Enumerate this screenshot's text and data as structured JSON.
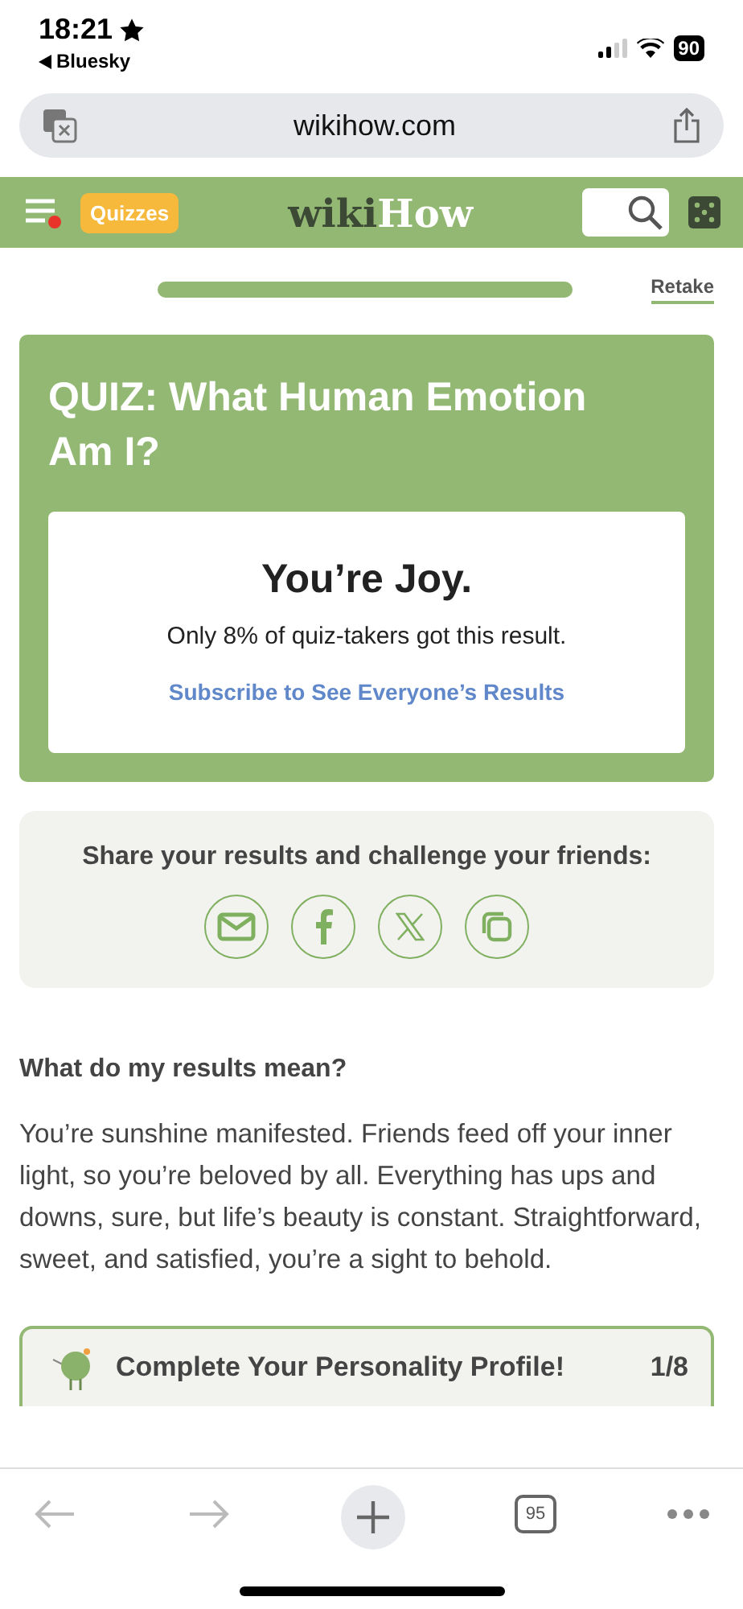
{
  "status_bar": {
    "time": "18:21",
    "back_app": "Bluesky",
    "battery": "90"
  },
  "url_bar": {
    "url": "wikihow.com"
  },
  "header": {
    "quizzes": "Quizzes",
    "logo_part_1": "wiki",
    "logo_part_2": "How",
    "menu_notification": true
  },
  "progress": {
    "level": 1,
    "retake": "Retake"
  },
  "quiz_card": {
    "title": "QUIZ: What Human Emotion Am I?",
    "result": "You’re Joy.",
    "stat": "Only 8% of quiz-takers got this result.",
    "subscribe": "Subscribe to See Everyone’s Results"
  },
  "share": {
    "heading": "Share your results and challenge your friends:",
    "buttons": [
      {
        "kind": "email"
      },
      {
        "kind": "facebook"
      },
      {
        "kind": "x"
      },
      {
        "kind": "copy"
      }
    ]
  },
  "results": {
    "heading": "What do my results mean?",
    "body": "You’re sunshine manifested. Friends feed off your inner light, so you’re beloved by all. Everything has ups and downs, sure, but life’s beauty is constant. Straightforward, sweet, and satisfied, you’re a sight to behold."
  },
  "profile": {
    "title": "Complete Your Personality Profile!",
    "count": "1/8"
  },
  "toolbar": {
    "tabs": "95"
  }
}
